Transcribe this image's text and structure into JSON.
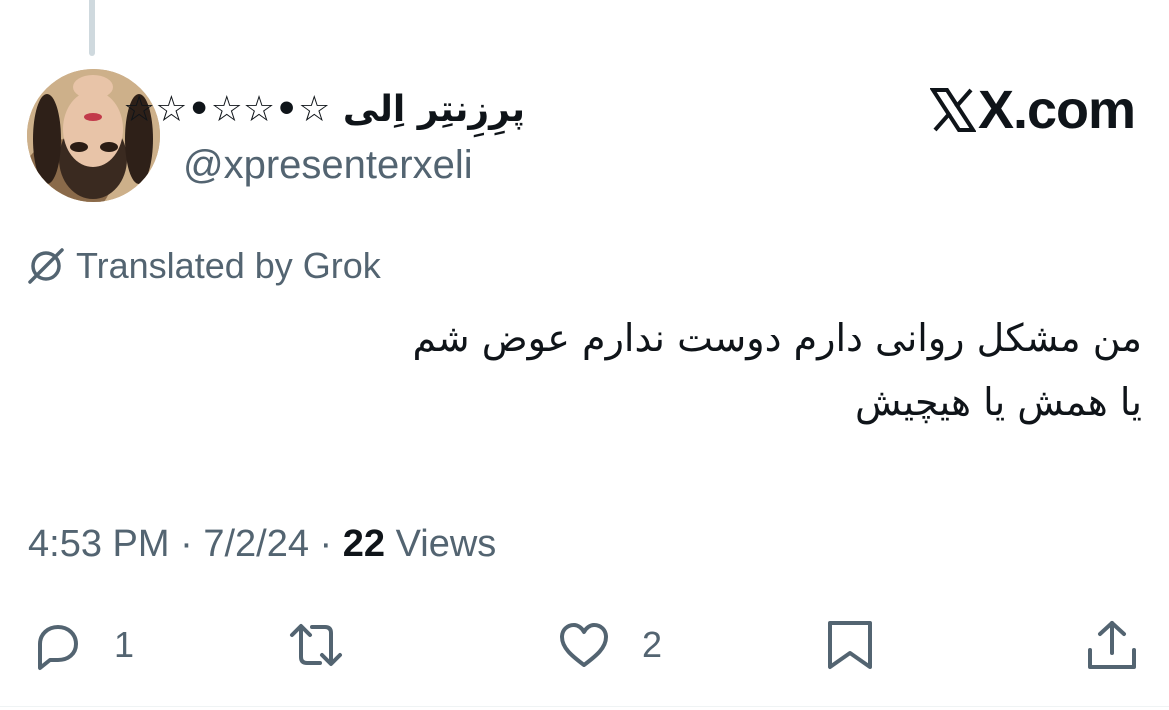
{
  "post": {
    "display_name": "پرِزِنتِر اِلی ☆•☆☆•☆☆",
    "handle": "@xpresenterxeli",
    "brand": "X.com",
    "brand_icon": "x-logo-icon",
    "translation_label": "Translated by Grok",
    "text_lines": [
      "من مشکل روانی دارم دوست ندارم عوض شم",
      "یا همش یا هیچیش"
    ],
    "time": "4:53 PM",
    "date": "7/2/24",
    "separator": " · ",
    "views_count": "22",
    "views_label": "Views"
  },
  "actions": {
    "reply": {
      "icon": "reply-icon",
      "count": "1"
    },
    "repost": {
      "icon": "repost-icon"
    },
    "like": {
      "icon": "heart-icon",
      "count": "2"
    },
    "bookmark": {
      "icon": "bookmark-icon"
    },
    "share": {
      "icon": "share-icon"
    }
  },
  "colors": {
    "text_primary": "#0f1419",
    "text_secondary": "#536471",
    "thread_line": "#cfd9de"
  }
}
